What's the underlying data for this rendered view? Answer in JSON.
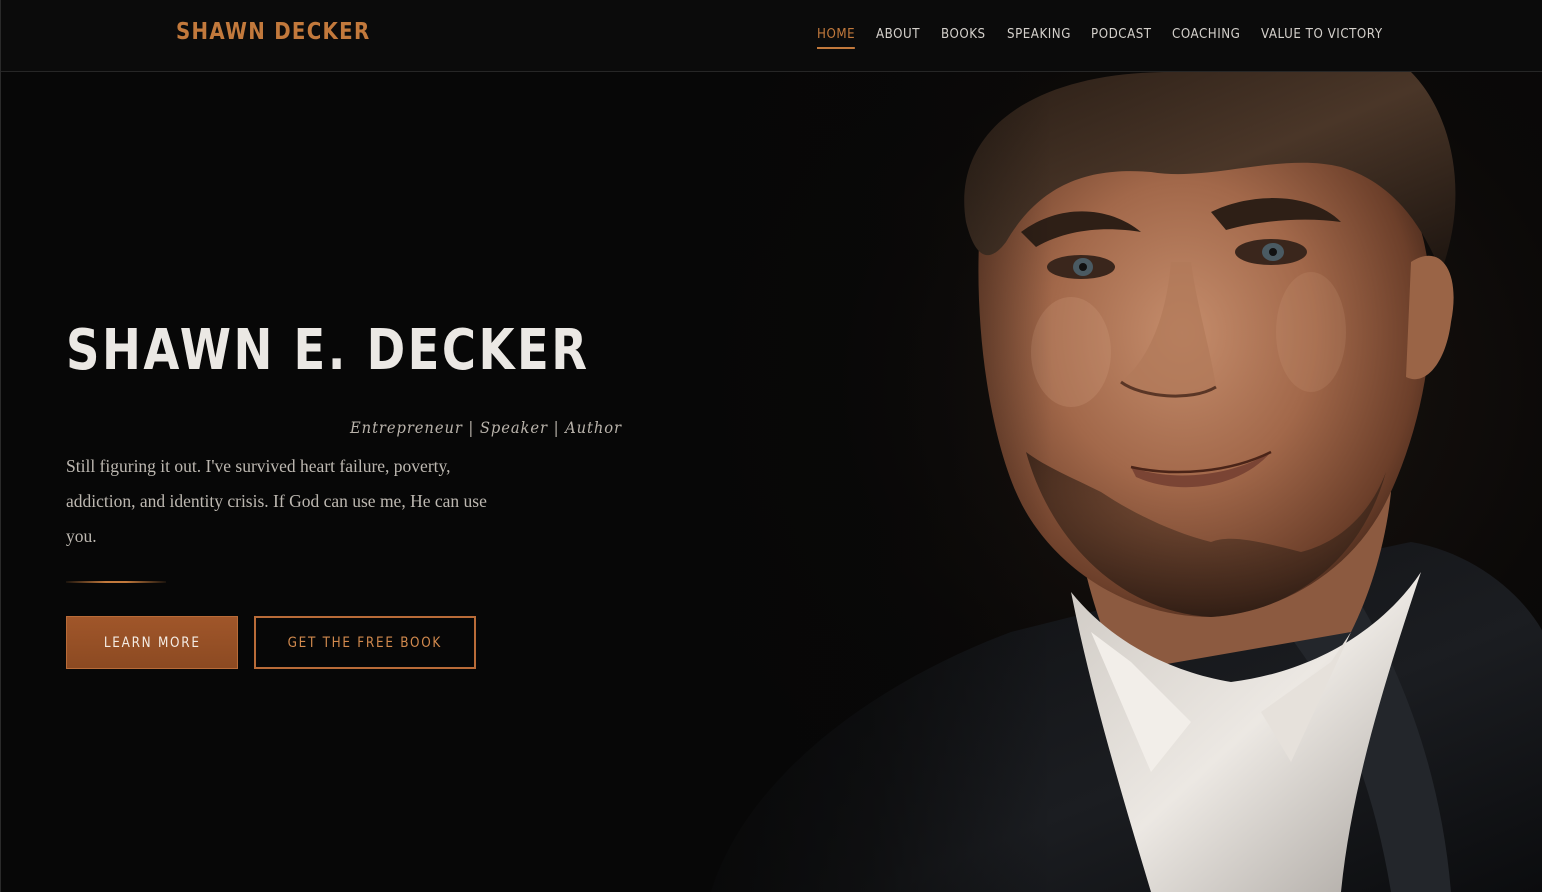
{
  "header": {
    "brand": "SHAWN DECKER",
    "nav": [
      {
        "label": "HOME",
        "active": true
      },
      {
        "label": "ABOUT",
        "active": false
      },
      {
        "label": "BOOKS",
        "active": false
      },
      {
        "label": "SPEAKING",
        "active": false
      },
      {
        "label": "PODCAST",
        "active": false
      },
      {
        "label": "COACHING",
        "active": false
      },
      {
        "label": "VALUE TO VICTORY",
        "active": false
      }
    ]
  },
  "hero": {
    "title": "SHAWN E. DECKER",
    "tagline": "Entrepreneur | Speaker | Author",
    "intro_lines": [
      "Still figuring it out. I've survived heart failure, poverty,",
      "addiction, and identity crisis. If God can use me, He can use",
      "you."
    ],
    "primary_button": "LEARN MORE",
    "secondary_button": "GET THE FREE BOOK"
  },
  "colors": {
    "accent": "#c2793c",
    "background": "#070707",
    "header_bg": "#0b0b0b",
    "title_text": "#ebe8e4"
  },
  "icons": {
    "portrait": "man-portrait-photo"
  }
}
